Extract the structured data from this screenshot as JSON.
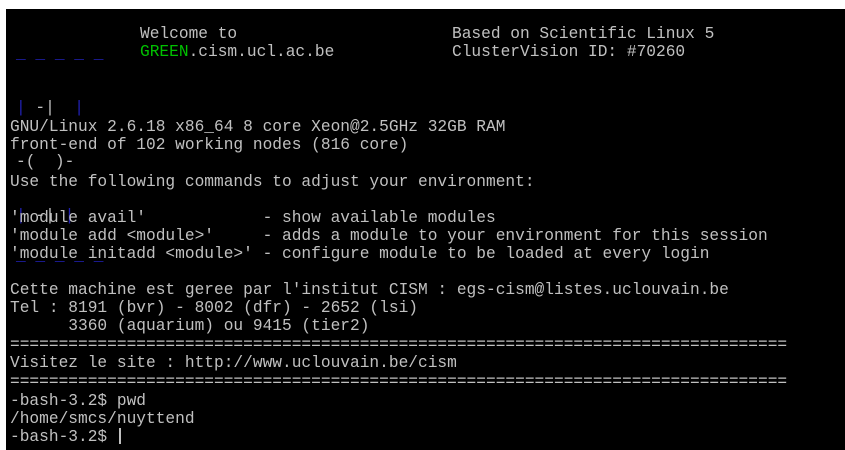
{
  "banner": {
    "logo": {
      "row0": "_ _ _ _ _",
      "row1_a": "|",
      "row1_b": " -| ",
      "row1_c": " |",
      "row2_a": "-(",
      "row2_b": "  )-",
      "row3_a": "|",
      "row3_b": " -|",
      "row3_c": " |",
      "row4": "‾ ‾ ‾ ‾ ‾"
    },
    "welcome": "Welcome to",
    "hostname_green": "GREEN",
    "hostname_rest": ".cism.ucl.ac.be",
    "based_on": "Based on Scientific Linux 5",
    "clustervision": "ClusterVision ID: #70260"
  },
  "system": {
    "line1": "GNU/Linux 2.6.18 x86_64 8 core Xeon@2.5GHz 32GB RAM",
    "line2": "front-end of 102 working nodes (816 core)"
  },
  "instructions": {
    "intro": "Use the following commands to adjust your environment:",
    "cmd1": "'module avail'            - show available modules",
    "cmd2": "'module add <module>'     - adds a module to your environment for this session",
    "cmd3": "'module initadd <module>' - configure module to be loaded at every login"
  },
  "contact": {
    "line1": "Cette machine est geree par l'institut CISM : egs-cism@listes.uclouvain.be",
    "line2": "Tel : 8191 (bvr) - 8002 (dfr) - 2652 (lsi)",
    "line3": "      3360 (aquarium) ou 9415 (tier2)"
  },
  "separator": "================================================================================",
  "website": "Visitez le site : http://www.uclouvain.be/cism",
  "session": {
    "prompt1": "-bash-3.2$ pwd",
    "output1": "/home/smcs/nuyttend",
    "prompt2": "-bash-3.2$ "
  }
}
